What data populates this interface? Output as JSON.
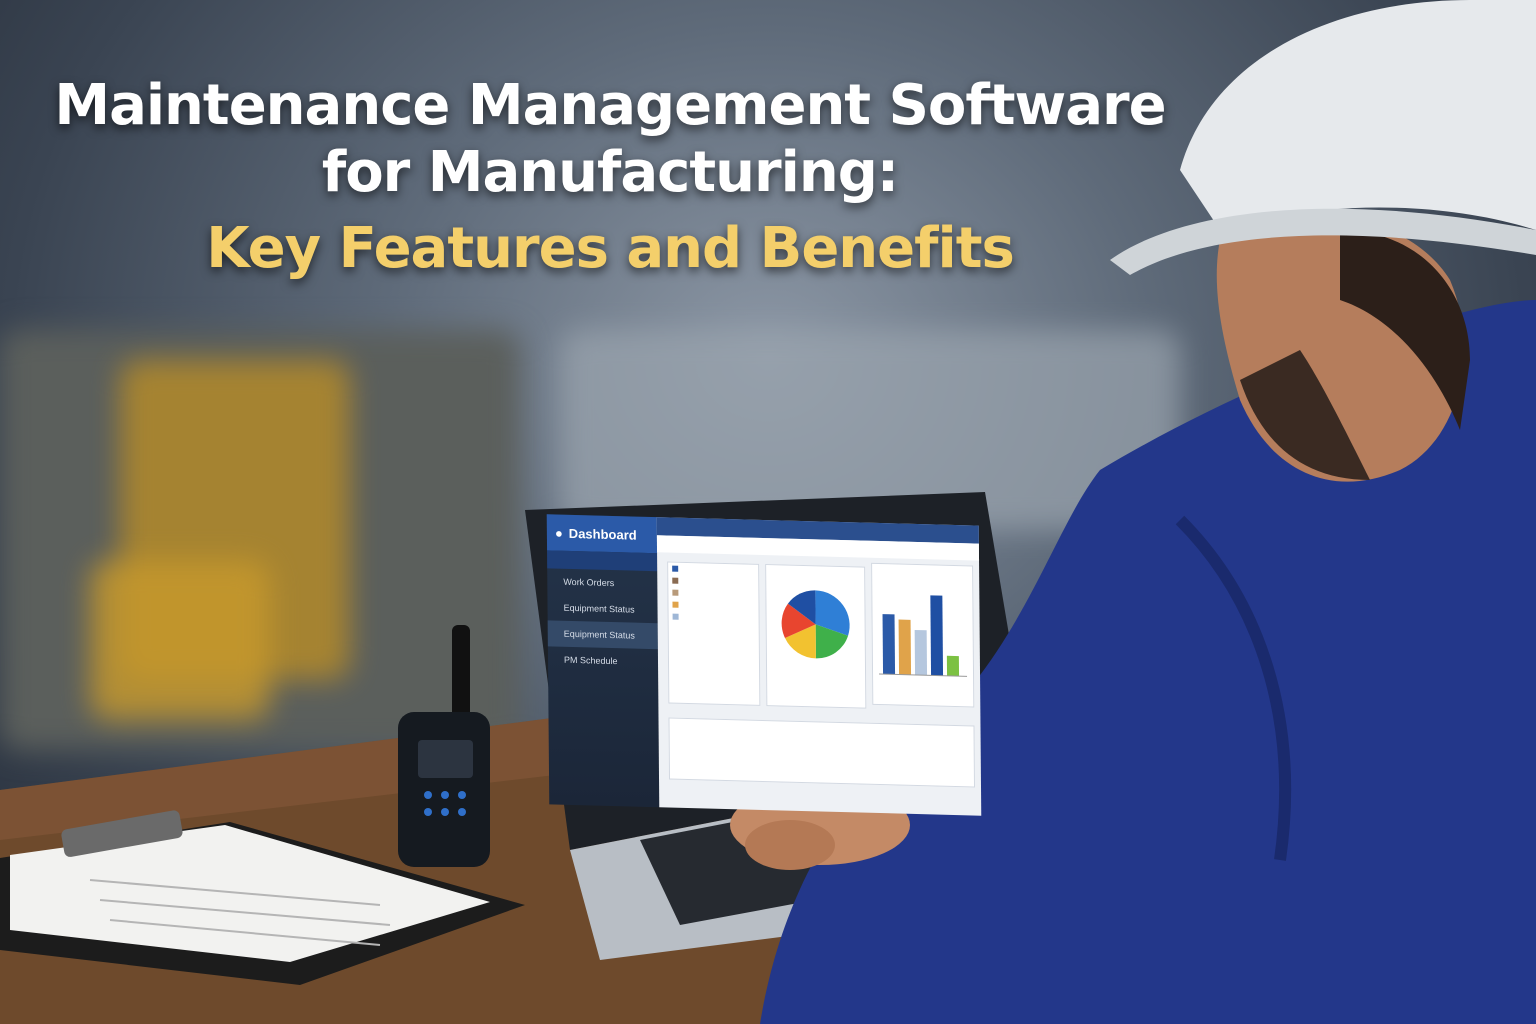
{
  "headline": {
    "line1": "Maintenance Management Software",
    "line2": "for Manufacturing:",
    "line3": "Key Features and Benefits"
  },
  "laptop_screen": {
    "app_title": "Dashboard",
    "sidebar_items": [
      "Work Orders",
      "Equipment Status",
      "Equipment Status",
      "PM Schedule"
    ]
  },
  "colors": {
    "headline_white": "#ffffff",
    "headline_accent": "#f4cf6b",
    "sidebar_header": "#2b5aa8",
    "jacket": "#23378a",
    "helmet": "#e6e9ec"
  },
  "chart_data": {
    "type": "bar",
    "categories": [
      "",
      "",
      "",
      "",
      ""
    ],
    "series": [
      {
        "values": [
          6,
          5.5,
          4.5,
          8,
          2
        ]
      }
    ],
    "pie": {
      "type": "pie",
      "values": [
        30,
        20,
        18,
        17,
        15
      ]
    }
  }
}
